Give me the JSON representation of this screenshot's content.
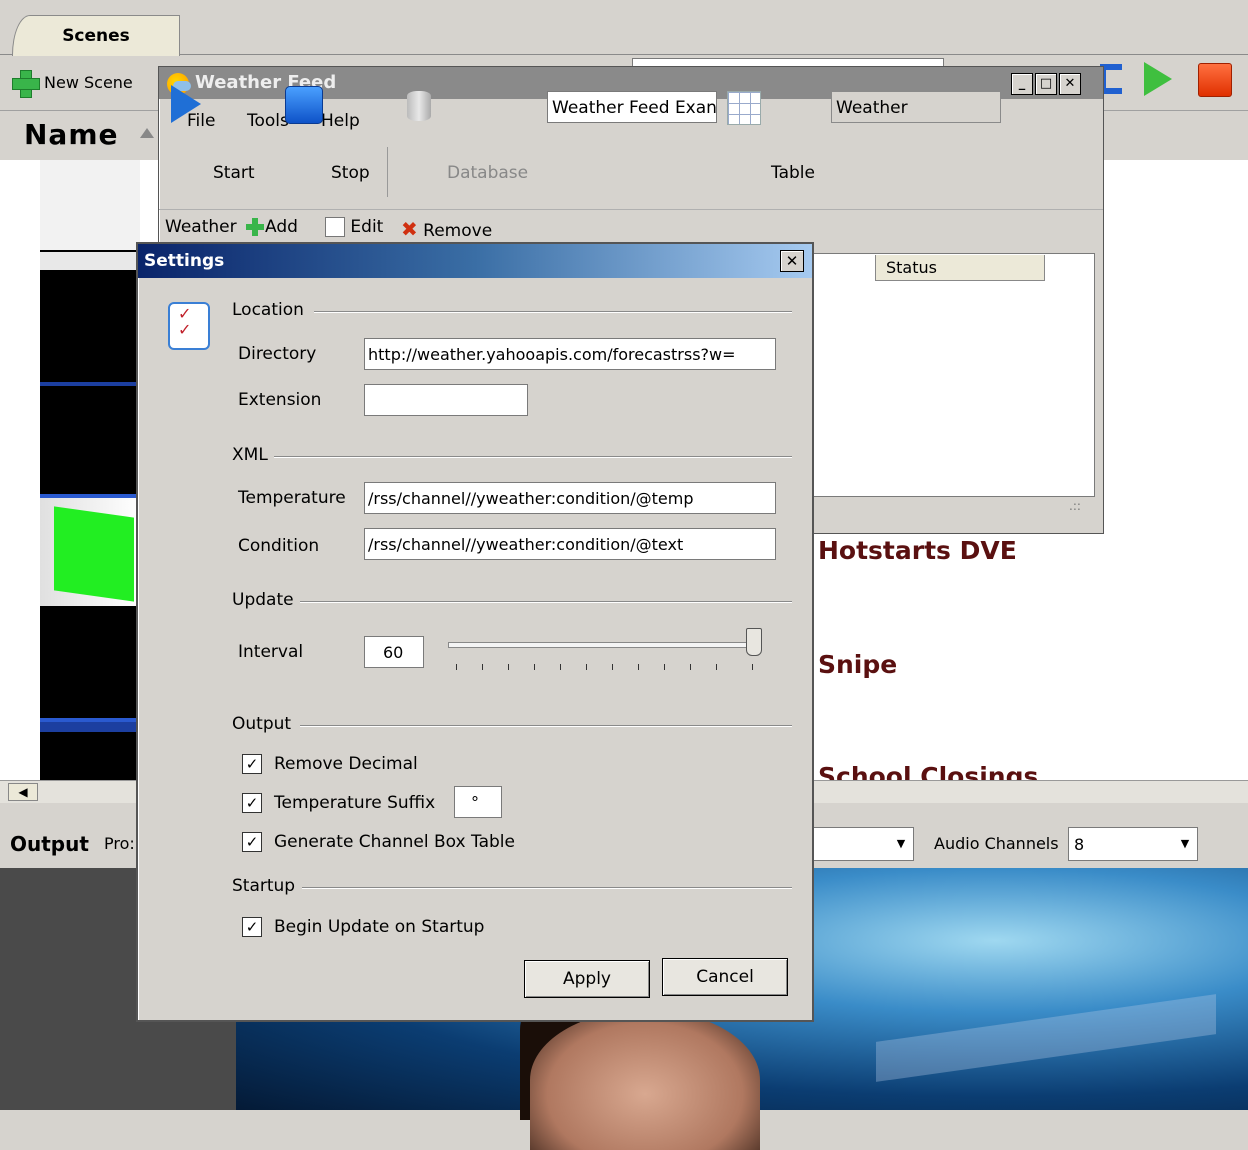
{
  "app": {
    "scenes_tab": "Scenes",
    "new_scene": "New Scene",
    "name_header": "Name",
    "scene_labels": [
      "Hotstarts DVE",
      "Snipe",
      "School Closings"
    ],
    "output": {
      "label": "Output",
      "profile_label": "Pro:",
      "audio_label": "Audio Channels",
      "audio_value": "8"
    }
  },
  "weather_feed": {
    "title": "Weather Feed",
    "menu": [
      "File",
      "Tools",
      "Help"
    ],
    "toolbar": {
      "start": "Start",
      "stop": "Stop",
      "database": "Database",
      "database_value": "Weather Feed Exan",
      "table": "Table",
      "table_value": "Weather"
    },
    "sub": {
      "label": "Weather",
      "add": "Add",
      "edit": "Edit",
      "remove": "Remove"
    },
    "list": {
      "columns": [
        "Status"
      ]
    }
  },
  "settings": {
    "title": "Settings",
    "location": {
      "group": "Location",
      "directory_label": "Directory",
      "directory_value": "http://weather.yahooapis.com/forecastrss?w=",
      "extension_label": "Extension",
      "extension_value": ""
    },
    "xml": {
      "group": "XML",
      "temperature_label": "Temperature",
      "temperature_value": "/rss/channel//yweather:condition/@temp",
      "condition_label": "Condition",
      "condition_value": "/rss/channel//yweather:condition/@text"
    },
    "update": {
      "group": "Update",
      "interval_label": "Interval",
      "interval_value": "60",
      "slider_level": 1.0
    },
    "output": {
      "group": "Output",
      "remove_decimal": "Remove Decimal",
      "remove_decimal_checked": true,
      "temperature_suffix": "Temperature Suffix",
      "temperature_suffix_checked": true,
      "suffix_value": "°",
      "channel_box": "Generate Channel Box Table",
      "channel_box_checked": true
    },
    "startup": {
      "group": "Startup",
      "begin_update": "Begin Update on Startup",
      "begin_update_checked": true
    },
    "buttons": {
      "apply": "Apply",
      "cancel": "Cancel"
    }
  }
}
